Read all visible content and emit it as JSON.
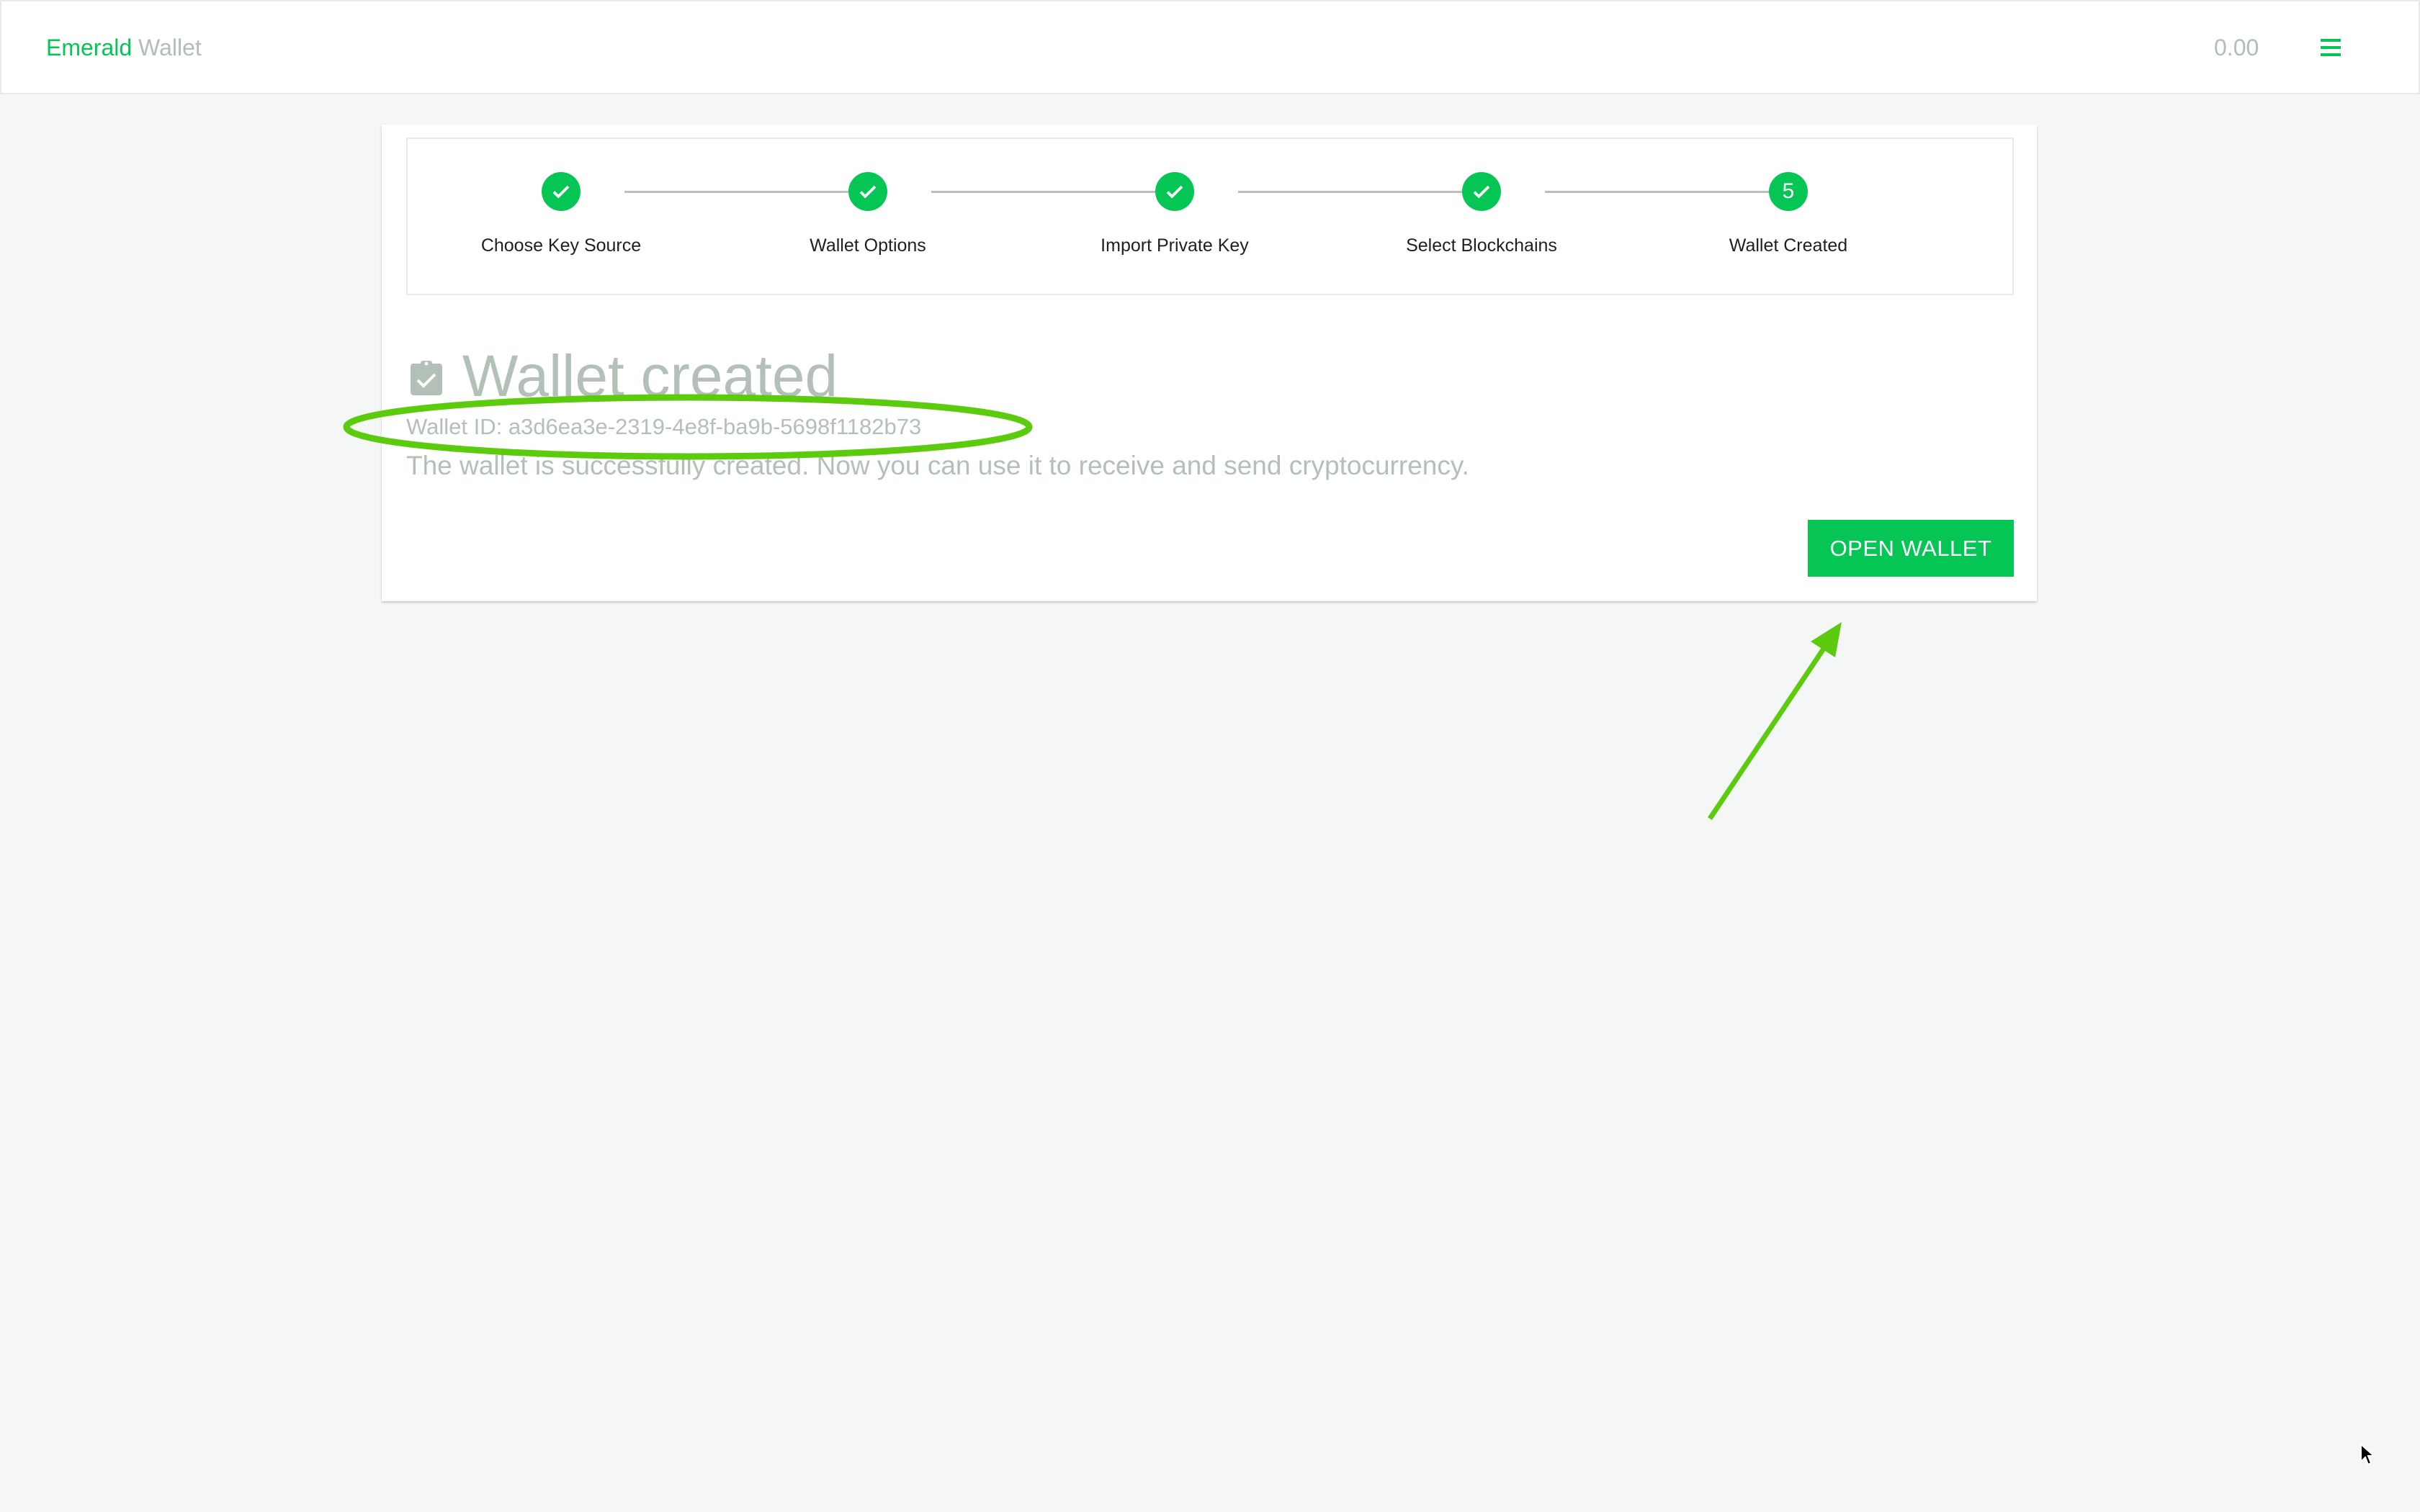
{
  "header": {
    "brand_primary": "Emerald",
    "brand_secondary": "Wallet",
    "balance": "0.00",
    "menu_icon": "hamburger-menu-icon"
  },
  "stepper": {
    "steps": [
      {
        "label": "Choose Key Source",
        "status": "completed",
        "icon": "check-icon"
      },
      {
        "label": "Wallet Options",
        "status": "completed",
        "icon": "check-icon"
      },
      {
        "label": "Import Private Key",
        "status": "completed",
        "icon": "check-icon"
      },
      {
        "label": "Select Blockchains",
        "status": "completed",
        "icon": "check-icon"
      },
      {
        "label": "Wallet Created",
        "status": "active",
        "number": "5"
      }
    ]
  },
  "content": {
    "title_icon": "clipboard-check-icon",
    "title": "Wallet created",
    "wallet_id": "Wallet ID: a3d6ea3e-2319-4e8f-ba9b-5698f1182b73",
    "description": "The wallet is successfully created. Now you can use it to receive and send cryptocurrency.",
    "open_wallet_label": "OPEN WALLET"
  },
  "annotations": {
    "highlight_ellipse_target": "wallet-id",
    "arrow_target": "open-wallet-button",
    "annotation_color": "#5ccb0e"
  },
  "colors": {
    "accent": "#05c655",
    "muted_text": "#b3c0b7",
    "background": "#f5f7f6"
  }
}
